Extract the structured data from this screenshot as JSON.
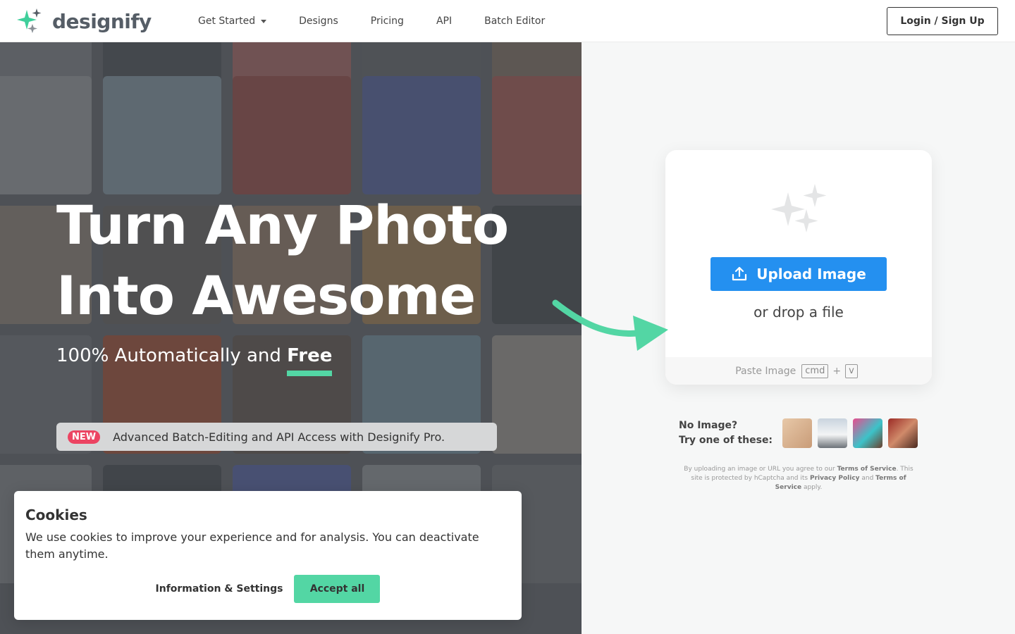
{
  "header": {
    "logo_text": "designify",
    "nav": [
      {
        "label": "Get Started"
      },
      {
        "label": "Designs"
      },
      {
        "label": "Pricing"
      },
      {
        "label": "API"
      },
      {
        "label": "Batch Editor"
      }
    ],
    "login_label": "Login / Sign Up"
  },
  "hero": {
    "title_line1": "Turn Any Photo",
    "title_line2": "Into Awesome",
    "subtitle_prefix": "100% Automatically and ",
    "subtitle_free": "Free",
    "promo_badge": "NEW",
    "promo_text": "Advanced Batch-Editing and API Access with Designify Pro."
  },
  "upload": {
    "button_label": "Upload Image",
    "drop_text": "or drop a file",
    "paste_label": "Paste Image",
    "paste_key1": "cmd",
    "paste_plus": "+",
    "paste_key2": "v"
  },
  "samples": {
    "line1": "No Image?",
    "line2": "Try one of these:"
  },
  "terms": {
    "t1": "By uploading an image or URL you agree to our ",
    "link1": "Terms of Service",
    "t2": ". This site is protected by hCaptcha and its ",
    "link2": "Privacy Policy",
    "t3": " and ",
    "link3": "Terms of Service",
    "t4": " apply."
  },
  "cookies": {
    "title": "Cookies",
    "text": "We use cookies to improve your experience and for analysis. You can deactivate them anytime.",
    "info_label": "Information & Settings",
    "accept_label": "Accept all"
  },
  "colors": {
    "accent_green": "#53d6a4",
    "upload_blue": "#2490f0",
    "new_badge": "#ec4462"
  }
}
